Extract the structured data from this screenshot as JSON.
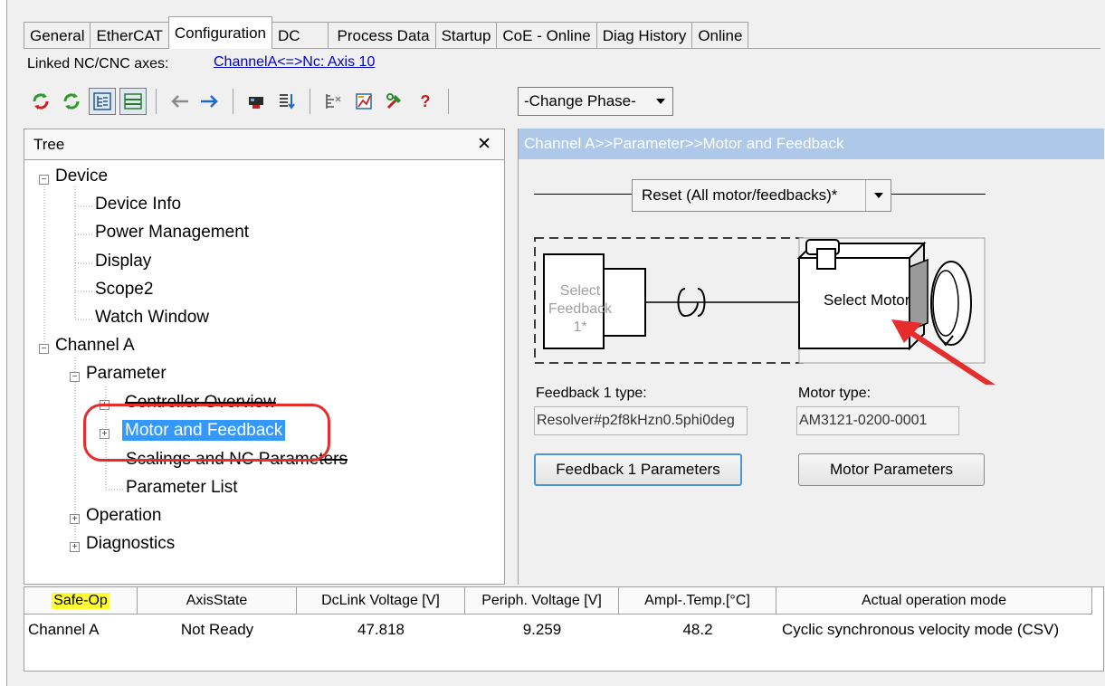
{
  "tabs": [
    "General",
    "EtherCAT",
    "Configuration",
    "DC",
    "Process Data",
    "Startup",
    "CoE - Online",
    "Diag History",
    "Online"
  ],
  "active_tab": "Configuration",
  "linked": {
    "label": "Linked NC/CNC axes:",
    "value": "ChannelA<=>Nc: Axis 10"
  },
  "toolbar": {
    "icons": [
      "refresh-red-icon",
      "refresh-green-icon",
      "tree-view-icon",
      "panel-view-icon",
      "back-arrow-icon",
      "forward-arrow-icon",
      "upload-device-icon",
      "download-list-icon",
      "compare-icon",
      "chart-icon",
      "tools-icon",
      "help-icon"
    ],
    "help": "?",
    "phase_select": "-Change Phase-"
  },
  "tree": {
    "title": "Tree",
    "close": "✕",
    "items": {
      "device": "Device",
      "device_info": "Device Info",
      "power_management": "Power Management",
      "display": "Display",
      "scope2": "Scope2",
      "watch_window": "Watch Window",
      "channel_a": "Channel A",
      "parameter": "Parameter",
      "controller_overview": "Controller Overview",
      "motor_and_feedback": "Motor and Feedback",
      "scalings": "Scalings and NC Parameters",
      "parameter_list": "Parameter List",
      "operation": "Operation",
      "diagnostics": "Diagnostics"
    },
    "selected": "Motor and Feedback"
  },
  "right": {
    "breadcrumb": "Channel A>>Parameter>>Motor and Feedback",
    "reset_select": "Reset (All motor/feedbacks)*",
    "feedback_box_label_line1": "Select",
    "feedback_box_label_line2": "Feedback 1*",
    "motor_box_label": "Select Motor",
    "feedback_type_label": "Feedback 1 type:",
    "feedback_type_value": "Resolver#p2f8kHzn0.5phi0deg",
    "motor_type_label": "Motor type:",
    "motor_type_value": "AM3121-0200-0001",
    "feedback_button": "Feedback 1 Parameters",
    "motor_button": "Motor Parameters"
  },
  "status_table": {
    "columns": [
      "Safe-Op",
      "AxisState",
      "DcLink Voltage [V]",
      "Periph. Voltage [V]",
      "Ampl-.Temp.[°C]",
      "Actual operation mode"
    ],
    "rows": [
      [
        "Channel A",
        "Not Ready",
        "47.818",
        "9.259",
        "48.2",
        "Cyclic synchronous velocity mode (CSV)"
      ]
    ]
  },
  "colors": {
    "selection": "#3399ff",
    "annotation_red": "#e62c2c",
    "header_blue": "#aec8ea",
    "state_highlight": "#ffff33"
  }
}
